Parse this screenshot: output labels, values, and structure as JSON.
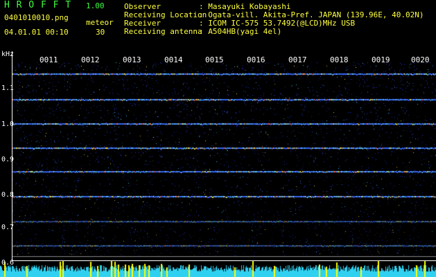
{
  "header": {
    "app_name": "H R O F F T",
    "version": "1.00",
    "filename": "0401010010.png",
    "datetime": "04.01.01 00:10",
    "meteor_label": "meteor",
    "meteor_count": "30",
    "info": [
      {
        "label": "Observer",
        "value": ": Masayuki Kobayashi"
      },
      {
        "label": "Receiving Location",
        "value": ": Ogata-vill. Akita-Pref. JAPAN (139.96E, 40.02N)"
      },
      {
        "label": "Receiver",
        "value": ": ICOM IC-575 53.7492(@LCD)MHz USB"
      },
      {
        "label": "Receiving antenna",
        "value": ": A504HB(yagi 4el)"
      }
    ]
  },
  "axis": {
    "unit": "kHz",
    "y_ticks": [
      "1.1",
      "1.0",
      "0.9",
      "0.8",
      "0.7",
      "0.6"
    ],
    "x_ticks": [
      "0011",
      "0012",
      "0013",
      "0014",
      "0015",
      "0016",
      "0017",
      "0018",
      "0019",
      "0020"
    ]
  },
  "colors": {
    "background": "#000000",
    "noise_base": "#0a0a60",
    "trace": "#4080ff",
    "header_yellow": "#ffff40",
    "header_green": "#40ff40",
    "bottom_bar": "#40e0ff",
    "bottom_spikes": "#ffff00"
  }
}
